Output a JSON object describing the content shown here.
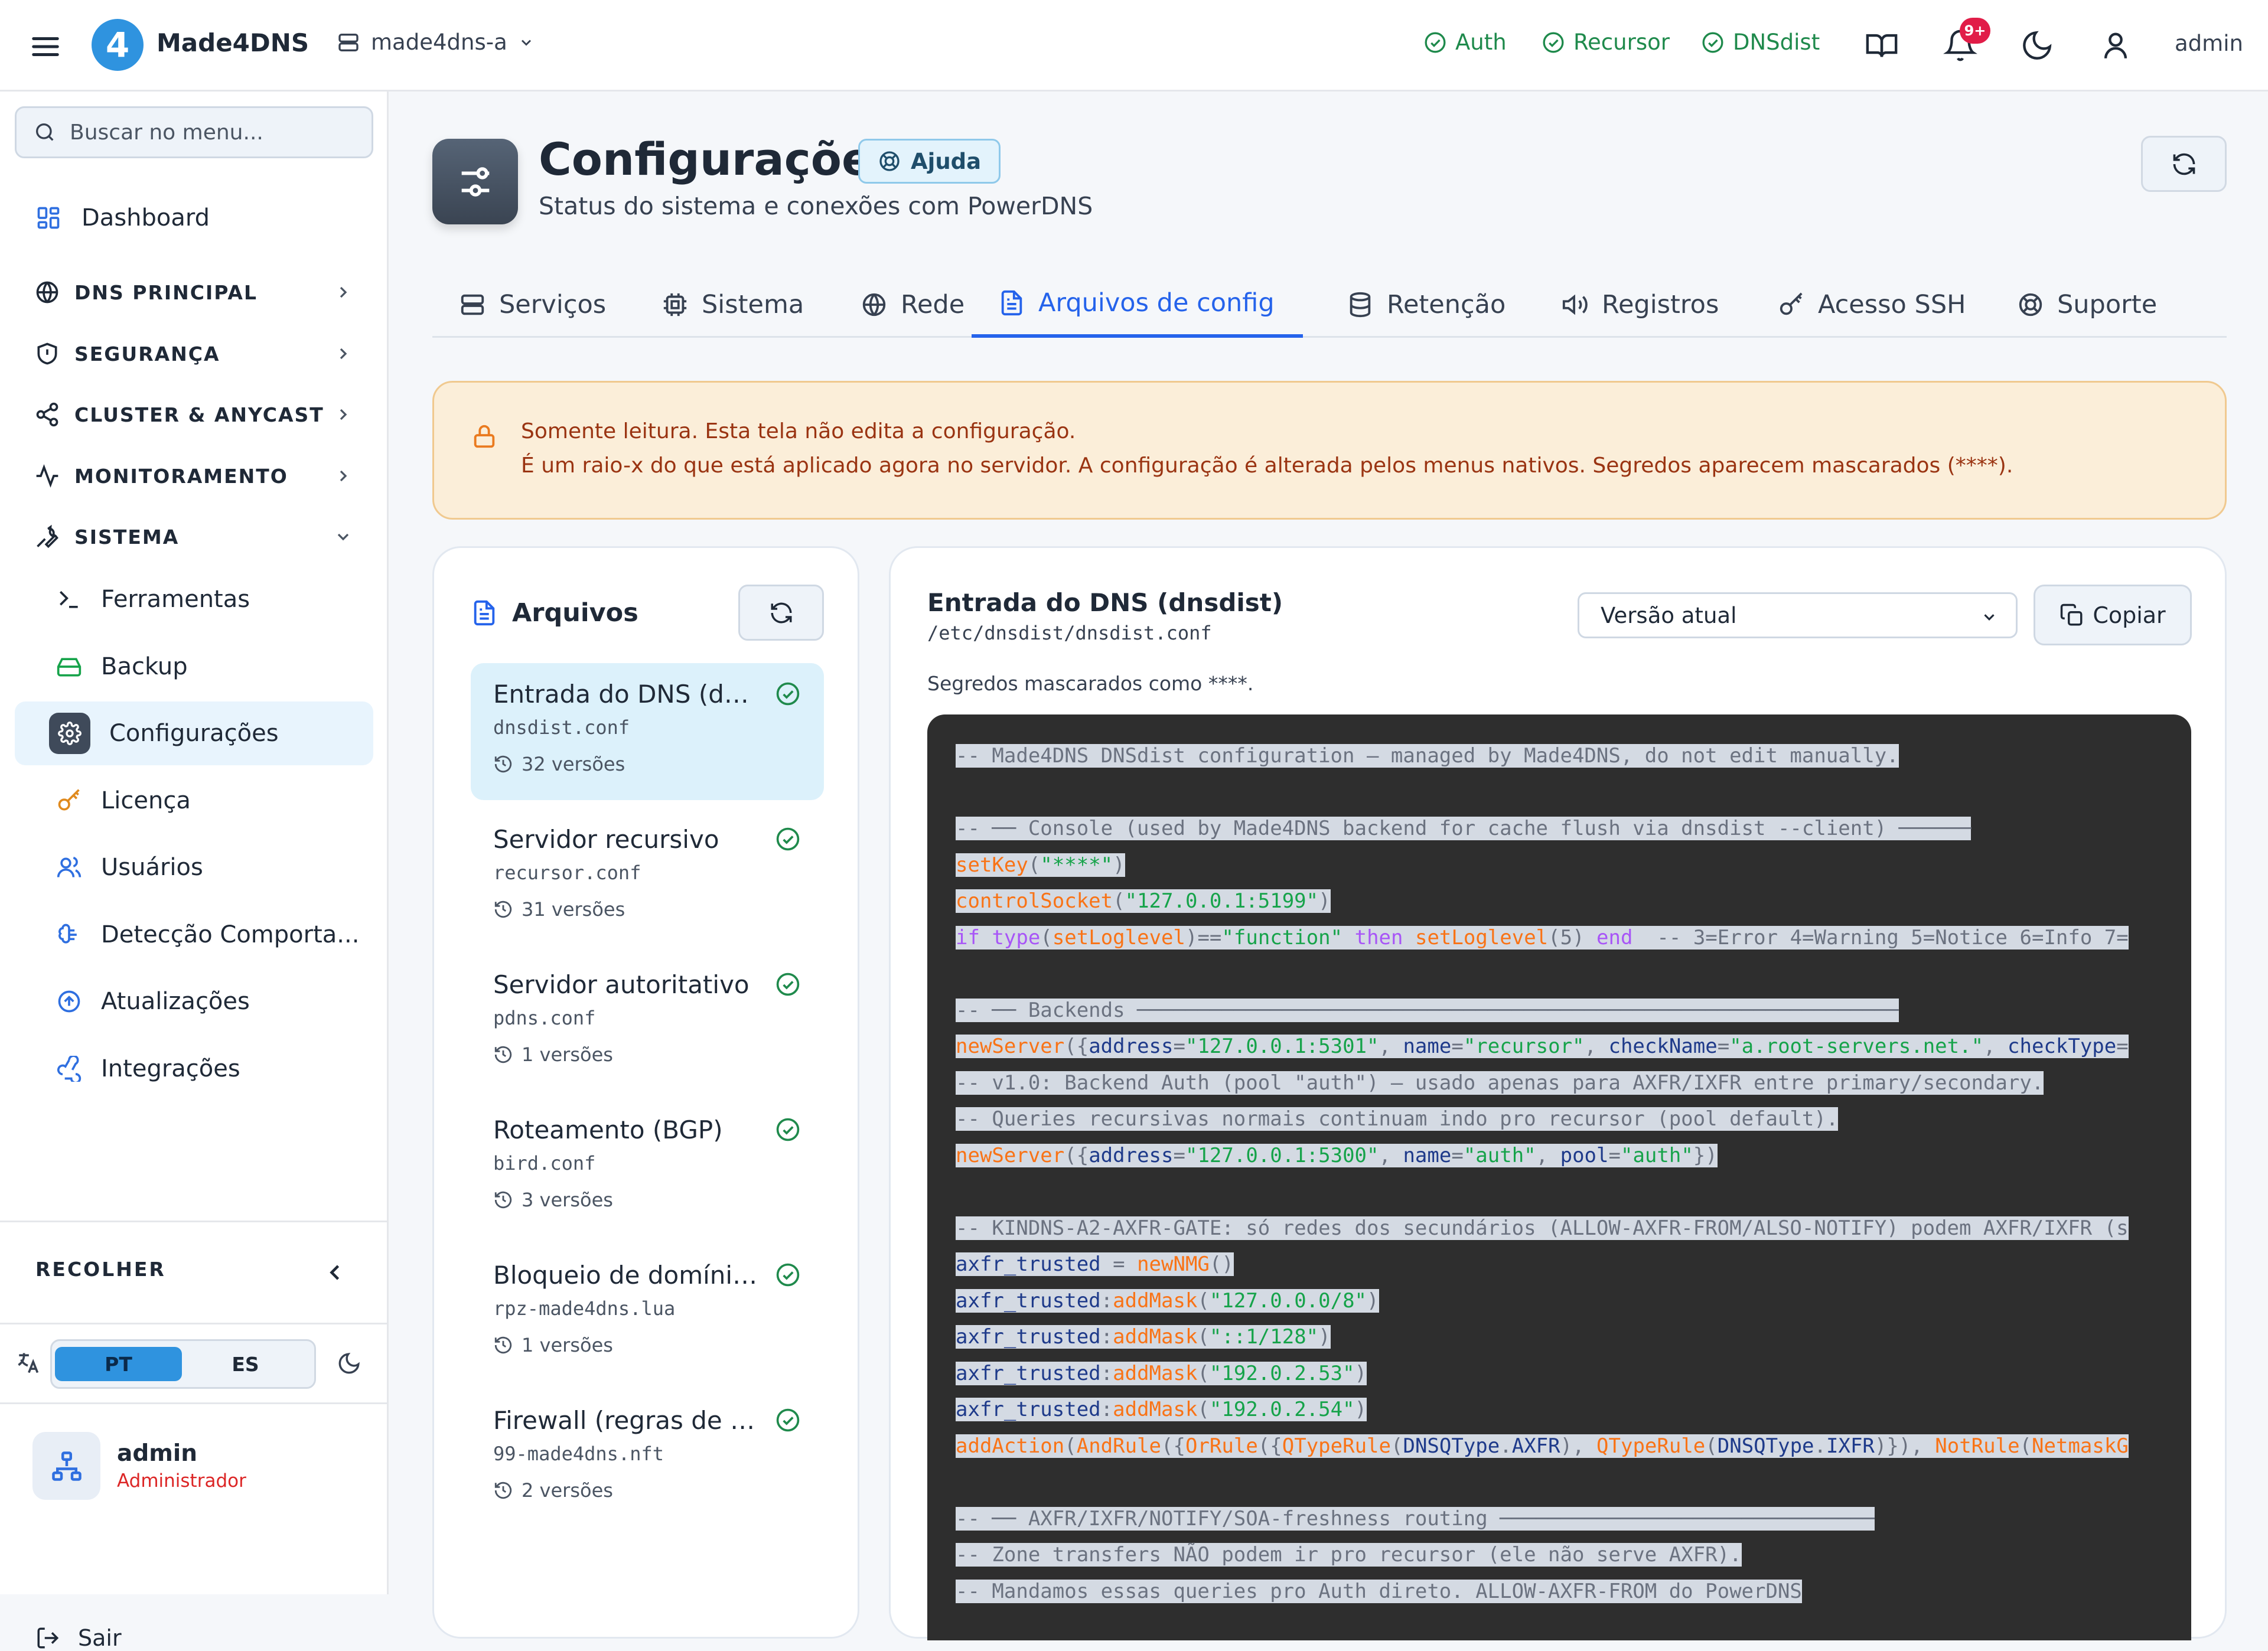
{
  "topbar": {
    "brand": "Made4DNS",
    "logo_glyph": "4",
    "server_selector": "made4dns-a",
    "services": [
      {
        "label": "Auth",
        "status": "ok"
      },
      {
        "label": "Recursor",
        "status": "ok"
      },
      {
        "label": "DNSdist",
        "status": "ok"
      }
    ],
    "notification_count": "9+",
    "user": "admin",
    "accent": "#2563eb",
    "ok_color": "#1f8a4c"
  },
  "sidebar": {
    "search_placeholder": "Buscar no menu...",
    "dashboard": "Dashboard",
    "sections": [
      "DNS PRINCIPAL",
      "SEGURANÇA",
      "CLUSTER & ANYCAST",
      "MONITORAMENTO",
      "SISTEMA"
    ],
    "system_items": [
      "Ferramentas",
      "Backup",
      "Configurações",
      "Licença",
      "Usuários",
      "Detecção Comporta...",
      "Atualizações",
      "Integrações"
    ],
    "collapse_label": "RECOLHER",
    "languages": [
      "PT",
      "ES"
    ],
    "active_language": "PT",
    "user_name": "admin",
    "user_role": "Administrador",
    "logout": "Sair"
  },
  "page": {
    "title": "Configurações",
    "help": "Ajuda",
    "subtitle": "Status do sistema e conexões com PowerDNS",
    "tabs": [
      "Serviços",
      "Sistema",
      "Rede",
      "Arquivos de config",
      "Retenção",
      "Registros",
      "Acesso SSH",
      "Suporte"
    ],
    "active_tab": "Arquivos de config"
  },
  "alert": {
    "line1": "Somente leitura. Esta tela não edita a configuração.",
    "line2": "É um raio-x do que está aplicado agora no servidor. A configuração é alterada pelos menus nativos. Segredos aparecem mascarados (****)."
  },
  "files": {
    "heading": "Arquivos",
    "items": [
      {
        "name": "Entrada do DNS (dns...",
        "path": "dnsdist.conf",
        "versions": "32 versões"
      },
      {
        "name": "Servidor recursivo",
        "path": "recursor.conf",
        "versions": "31 versões"
      },
      {
        "name": "Servidor autoritativo",
        "path": "pdns.conf",
        "versions": "1 versões"
      },
      {
        "name": "Roteamento (BGP)",
        "path": "bird.conf",
        "versions": "3 versões"
      },
      {
        "name": "Bloqueio de domínio...",
        "path": "rpz-made4dns.lua",
        "versions": "1 versões"
      },
      {
        "name": "Firewall (regras de re...",
        "path": "99-made4dns.nft",
        "versions": "2 versões"
      }
    ]
  },
  "viewer": {
    "title": "Entrada do DNS (dnsdist)",
    "path": "/etc/dnsdist/dnsdist.conf",
    "version_select": "Versão atual",
    "copy": "Copiar",
    "masked_note": "Segredos mascarados como ****.",
    "code": [
      "-- Made4DNS DNSdist configuration — managed by Made4DNS, do not edit manually.",
      "",
      "-- ── Console (used by Made4DNS backend for cache flush via dnsdist --client) ──────",
      "setKey(\"****\")",
      "controlSocket(\"127.0.0.1:5199\")",
      "if type(setLoglevel)==\"function\" then setLoglevel(5) end  -- 3=Error 4=Warning 5=Notice 6=Info 7=",
      "",
      "-- ── Backends ───────────────────────────────────────────────────────────────",
      "newServer({address=\"127.0.0.1:5301\", name=\"recursor\", checkName=\"a.root-servers.net.\", checkType=",
      "-- v1.0: Backend Auth (pool \"auth\") — usado apenas para AXFR/IXFR entre primary/secondary.",
      "-- Queries recursivas normais continuam indo pro recursor (pool default).",
      "newServer({address=\"127.0.0.1:5300\", name=\"auth\", pool=\"auth\"})",
      "",
      "-- KINDNS-A2-AXFR-GATE: só redes dos secundários (ALLOW-AXFR-FROM/ALSO-NOTIFY) podem AXFR/IXFR (s",
      "axfr_trusted = newNMG()",
      "axfr_trusted:addMask(\"127.0.0.0/8\")",
      "axfr_trusted:addMask(\"::1/128\")",
      "axfr_trusted:addMask(\"192.0.2.53\")",
      "axfr_trusted:addMask(\"192.0.2.54\")",
      "addAction(AndRule({OrRule({QTypeRule(DNSQType.AXFR), QTypeRule(DNSQType.IXFR)}), NotRule(NetmaskG",
      "",
      "-- ── AXFR/IXFR/NOTIFY/SOA-freshness routing ───────────────────────────────",
      "-- Zone transfers NÃO podem ir pro recursor (ele não serve AXFR).",
      "-- Mandamos essas queries pro Auth direto. ALLOW-AXFR-FROM do PowerDNS"
    ]
  }
}
